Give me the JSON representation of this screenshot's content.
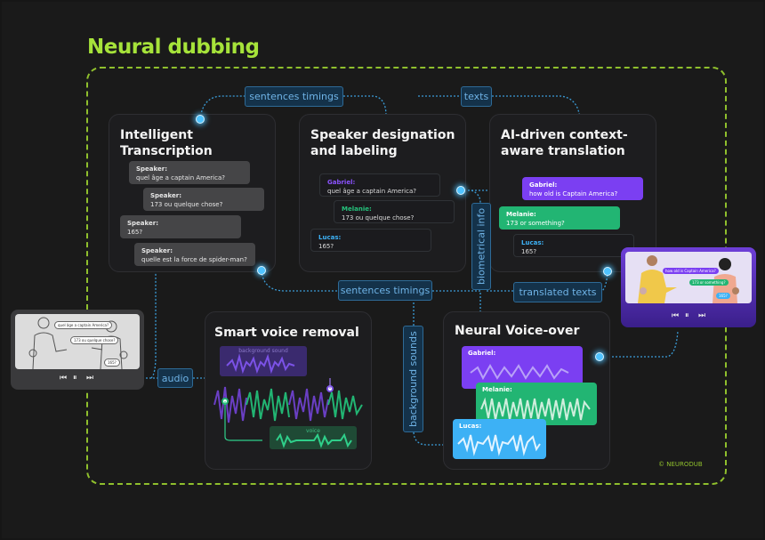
{
  "title": "Neural dubbing",
  "footer": "© NEURODUB",
  "colors": {
    "accent_green": "#a6e33a",
    "purple": "#7b3ff2",
    "green": "#22b573",
    "blue": "#3db1f5",
    "tag_blue": "#6fb3e6"
  },
  "tags": {
    "sentences_timings_top": "sentences timings",
    "texts": "texts",
    "biometrical_info": "biometrical info",
    "sentences_timings_mid": "sentences timings",
    "translated_texts": "translated texts",
    "audio": "audio",
    "background_sounds": "background sounds"
  },
  "transcription": {
    "title_line1": "Intelligent",
    "title_line2": "Transcription",
    "bubbles": [
      {
        "speaker": "Speaker:",
        "text": "quel âge a captain America?"
      },
      {
        "speaker": "Speaker:",
        "text": "173 ou quelque chose?"
      },
      {
        "speaker": "Speaker:",
        "text": "165?"
      },
      {
        "speaker": "Speaker:",
        "text": "quelle est la force de spider-man?"
      }
    ]
  },
  "speaker": {
    "title_line1": "Speaker designation",
    "title_line2": "and labeling",
    "bubbles": [
      {
        "speaker": "Gabriel:",
        "text": "quel âge a captain America?"
      },
      {
        "speaker": "Melanie:",
        "text": "173 ou quelque chose?"
      },
      {
        "speaker": "Lucas:",
        "text": "165?"
      }
    ]
  },
  "translation": {
    "title_line1": "AI-driven context-",
    "title_line2": "aware translation",
    "bubbles": [
      {
        "speaker": "Gabriel:",
        "text": "how old is Captain America?"
      },
      {
        "speaker": "Melanie:",
        "text": "173 or something?"
      },
      {
        "speaker": "Lucas:",
        "text": "165?"
      }
    ]
  },
  "voice_removal": {
    "title": "Smart voice removal",
    "background_label": "background sound",
    "voice_label": "voice"
  },
  "voice_over": {
    "title": "Neural Voice-over",
    "tracks": [
      {
        "speaker": "Gabriel:"
      },
      {
        "speaker": "Melanie:"
      },
      {
        "speaker": "Lucas:"
      }
    ]
  },
  "source_player": {
    "bubbles": [
      "quel âge a captain America?",
      "173 ou quelque chose?",
      "165?"
    ],
    "controls": {
      "prev": "⏮",
      "pause": "⏸",
      "next": "⏭"
    }
  },
  "output_player": {
    "bubbles": [
      "how old is Captain America?",
      "173 or something?",
      "165?"
    ],
    "controls": {
      "prev": "⏮",
      "pause": "⏸",
      "next": "⏭"
    }
  }
}
